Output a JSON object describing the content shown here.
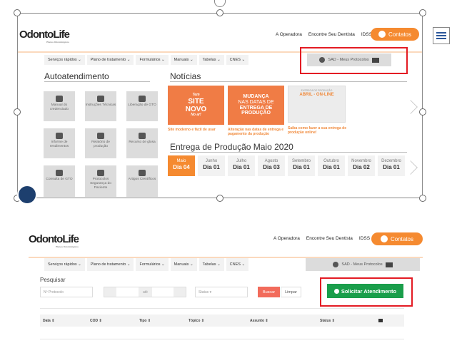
{
  "site": {
    "logo": "OdontoLife",
    "logo_sub": "Planos Odontológicos",
    "header_links": [
      "A Operadora",
      "Encontre Seu Dentista",
      "IDSS"
    ],
    "contatos": "Contatos",
    "nav": [
      "Serviços rápidos ⌄",
      "Plano de tratamento ⌄",
      "Formulários ⌄",
      "Manuais ⌄",
      "Tabelas ⌄",
      "CNES ⌄"
    ],
    "sad": "SAD - Meus Protocolos"
  },
  "home": {
    "auto_title": "Autoatendimento",
    "tiles": [
      "Manual do credenciado",
      "Instruções Técnicas",
      "Liberação de GTO",
      "Informe de rendimentos",
      "Relatório de produção",
      "Recurso de glosa",
      "Consulta de GTO",
      "Protocolos Segurança do Paciente",
      "Artigos Científicos"
    ],
    "news_title": "Notícias",
    "news": [
      {
        "img_lines": [
          "Tem",
          "SITE",
          "NOVO",
          "No ar!"
        ],
        "caption": "Site moderno e fácil de usar"
      },
      {
        "img_lines": [
          "MUDANÇA",
          "NAS DATAS DE",
          "ENTREGA DE",
          "PRODUÇÃO"
        ],
        "caption": "Alteração nas datas de entrega e pagamento da produção"
      },
      {
        "img_lines": [
          "ENTREGA DE PRODUÇÃO",
          "ABRIL - ON-LINE"
        ],
        "caption": "Saiba como fazer a sua entrega de produção online!"
      }
    ],
    "entrega_title": "Entrega de Produção Maio 2020",
    "days": [
      {
        "m": "Maio",
        "d": "Dia 04"
      },
      {
        "m": "Junho",
        "d": "Dia 01"
      },
      {
        "m": "Julho",
        "d": "Dia 01"
      },
      {
        "m": "Agosto",
        "d": "Dia 03"
      },
      {
        "m": "Setembro",
        "d": "Dia 01"
      },
      {
        "m": "Outubro",
        "d": "Dia 01"
      },
      {
        "m": "Novembro",
        "d": "Dia 02"
      },
      {
        "m": "Dezembro",
        "d": "Dia 01"
      }
    ],
    "accent": "#f58a30"
  },
  "protocols": {
    "search_label": "Pesquisar",
    "protocol_placeholder": "Nº Protocolo",
    "ate": "até",
    "status": "Status ▾",
    "buscar": "Buscar",
    "limpar": "Limpar",
    "solicitar": "Solicitar Atendimento",
    "columns": [
      "Data ⇕",
      "COD ⇕",
      "Tipo ⇕",
      "Tópico ⇕",
      "Assunto ⇕",
      "Status ⇕"
    ]
  }
}
